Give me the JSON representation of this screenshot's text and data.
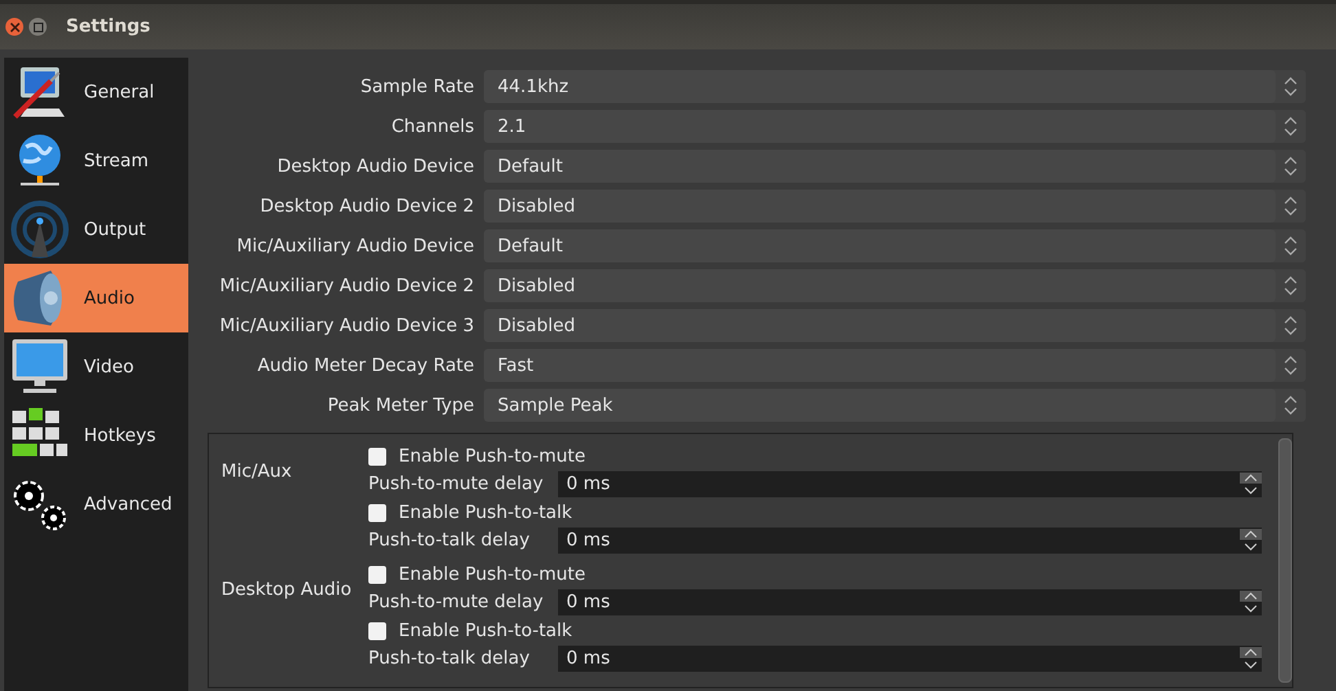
{
  "window": {
    "title": "Settings"
  },
  "sidebar": {
    "items": [
      {
        "label": "General",
        "kind": "general",
        "selected": false
      },
      {
        "label": "Stream",
        "kind": "stream",
        "selected": false
      },
      {
        "label": "Output",
        "kind": "output",
        "selected": false
      },
      {
        "label": "Audio",
        "kind": "audio",
        "selected": true
      },
      {
        "label": "Video",
        "kind": "video",
        "selected": false
      },
      {
        "label": "Hotkeys",
        "kind": "hotkeys",
        "selected": false
      },
      {
        "label": "Advanced",
        "kind": "advanced",
        "selected": false
      }
    ]
  },
  "settings": [
    {
      "label": "Sample Rate",
      "value": "44.1khz"
    },
    {
      "label": "Channels",
      "value": "2.1"
    },
    {
      "label": "Desktop Audio Device",
      "value": "Default"
    },
    {
      "label": "Desktop Audio Device 2",
      "value": "Disabled"
    },
    {
      "label": "Mic/Auxiliary Audio Device",
      "value": "Default"
    },
    {
      "label": "Mic/Auxiliary Audio Device 2",
      "value": "Disabled"
    },
    {
      "label": "Mic/Auxiliary Audio Device 3",
      "value": "Disabled"
    },
    {
      "label": "Audio Meter Decay Rate",
      "value": "Fast"
    },
    {
      "label": "Peak Meter Type",
      "value": "Sample Peak"
    }
  ],
  "hotkey_sections": [
    {
      "label": "Mic/Aux",
      "rows": [
        {
          "kind": "checkbox",
          "label": "Enable Push-to-mute",
          "checked": false
        },
        {
          "kind": "spin",
          "label": "Push-to-mute delay",
          "value": "0 ms"
        },
        {
          "kind": "checkbox",
          "label": "Enable Push-to-talk",
          "checked": false
        },
        {
          "kind": "spin",
          "label": "Push-to-talk delay",
          "value": "0 ms"
        }
      ]
    },
    {
      "label": "Desktop Audio",
      "rows": [
        {
          "kind": "checkbox",
          "label": "Enable Push-to-mute",
          "checked": false
        },
        {
          "kind": "spin",
          "label": "Push-to-mute delay",
          "value": "0 ms"
        },
        {
          "kind": "checkbox",
          "label": "Enable Push-to-talk",
          "checked": false
        },
        {
          "kind": "spin",
          "label": "Push-to-talk delay",
          "value": "0 ms"
        }
      ]
    }
  ]
}
